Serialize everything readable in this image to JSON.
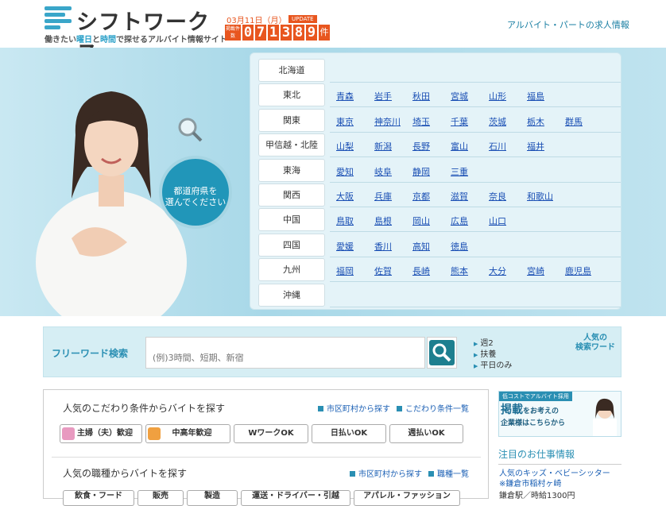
{
  "header": {
    "logo_text": "シフトワークス",
    "tagline_parts": [
      "働きたい",
      "曜日",
      "と",
      "時間",
      "で探せるアルバイト情報サイト"
    ],
    "date": "03月11日（月）",
    "update_badge": "UPDATE",
    "count_label": "掲載件数",
    "count_digits": [
      "0",
      "7",
      "1",
      "3",
      "8",
      "9"
    ],
    "count_unit": "件",
    "right_link": "アルバイト・パートの求人情報"
  },
  "hero": {
    "bubble_text_line1": "都道府県を",
    "bubble_text_line2": "選んでください",
    "regions": [
      {
        "name": "北海道",
        "prefs": []
      },
      {
        "name": "東北",
        "prefs": [
          "青森",
          "岩手",
          "秋田",
          "宮城",
          "山形",
          "福島"
        ]
      },
      {
        "name": "関東",
        "prefs": [
          "東京",
          "神奈川",
          "埼玉",
          "千葉",
          "茨城",
          "栃木",
          "群馬"
        ]
      },
      {
        "name": "甲信越・北陸",
        "prefs": [
          "山梨",
          "新潟",
          "長野",
          "富山",
          "石川",
          "福井"
        ]
      },
      {
        "name": "東海",
        "prefs": [
          "愛知",
          "岐阜",
          "静岡",
          "三重"
        ]
      },
      {
        "name": "関西",
        "prefs": [
          "大阪",
          "兵庫",
          "京都",
          "滋賀",
          "奈良",
          "和歌山"
        ]
      },
      {
        "name": "中国",
        "prefs": [
          "鳥取",
          "島根",
          "岡山",
          "広島",
          "山口"
        ]
      },
      {
        "name": "四国",
        "prefs": [
          "愛媛",
          "香川",
          "高知",
          "徳島"
        ]
      },
      {
        "name": "九州",
        "prefs": [
          "福岡",
          "佐賀",
          "長崎",
          "熊本",
          "大分",
          "宮崎",
          "鹿児島"
        ]
      },
      {
        "name": "沖縄",
        "prefs": []
      }
    ]
  },
  "search": {
    "title": "フリーワード検索",
    "placeholder": "(例)3時間、短期、新宿",
    "popular_badge_line1": "人気の",
    "popular_badge_line2": "検索ワード",
    "popular_words": [
      "週2",
      "扶養",
      "平日のみ"
    ]
  },
  "conditions": {
    "title": "人気のこだわり条件からバイトを探す",
    "link_city": "市区町村から探す",
    "link_all": "こだわり条件一覧",
    "tags": [
      "主婦（夫）歓迎",
      "中高年歓迎",
      "WワークOK",
      "日払いOK",
      "週払いOK"
    ]
  },
  "jobs": {
    "title": "人気の職種からバイトを探す",
    "link_city": "市区町村から探す",
    "link_all": "職種一覧",
    "tags": [
      "飲食・フード",
      "販売",
      "製造",
      "運送・ドライバー・引越",
      "アパレル・ファッション"
    ]
  },
  "sidebar": {
    "ad_top": "低コストでアルバイト採用",
    "ad_line1_big": "掲載",
    "ad_line1_rest": "をお考えの",
    "ad_line2": "企業様はこちらから",
    "featured_heading": "注目のお仕事情報",
    "featured_title": "人気のキッズ・ベビーシッター　※鎌倉市稲村ヶ崎",
    "featured_sub": "鎌倉駅／時給1300円"
  },
  "colors": {
    "accent": "#2a8fb3",
    "counter": "#e8561f",
    "link": "#1a5fb4"
  }
}
